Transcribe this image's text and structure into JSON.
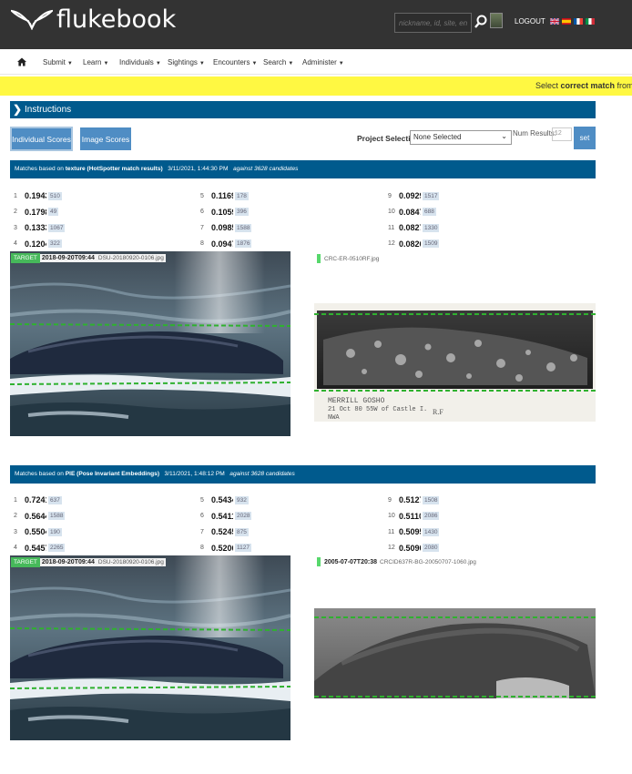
{
  "app": {
    "logo_text": "flukebook",
    "logout": "LOGOUT"
  },
  "search": {
    "placeholder": "nickname, id, site, encou"
  },
  "nav": {
    "items": [
      "Submit",
      "Learn",
      "Individuals",
      "Sightings",
      "Encounters",
      "Search",
      "Administer"
    ]
  },
  "banner": {
    "prefix": "Select ",
    "bold": "correct match",
    "suffix": " from res"
  },
  "instructions": {
    "label": "Instructions"
  },
  "toolbar": {
    "individual_scores": "Individual Scores",
    "image_scores": "Image Scores",
    "project_label": "Project Selection",
    "project_value": "None Selected",
    "num_results_label": "Num Results:",
    "num_results_value": "12",
    "set_label": "set"
  },
  "sections": [
    {
      "bar_prefix": "Matches based on ",
      "algorithm": "texture (HotSpotter match results)",
      "timestamp": "3/11/2021, 1:44:30 PM",
      "candidates": "against 3628 candidates",
      "scores": [
        {
          "rank": "1",
          "value": "0.1943",
          "id": "510"
        },
        {
          "rank": "2",
          "value": "0.1798",
          "id": "49"
        },
        {
          "rank": "3",
          "value": "0.1333",
          "id": "1067"
        },
        {
          "rank": "4",
          "value": "0.1204",
          "id": "322"
        },
        {
          "rank": "5",
          "value": "0.1169",
          "id": "178"
        },
        {
          "rank": "6",
          "value": "0.1059",
          "id": "396"
        },
        {
          "rank": "7",
          "value": "0.0985",
          "id": "1588"
        },
        {
          "rank": "8",
          "value": "0.0947",
          "id": "1876"
        },
        {
          "rank": "9",
          "value": "0.0929",
          "id": "1517"
        },
        {
          "rank": "10",
          "value": "0.0847",
          "id": "688"
        },
        {
          "rank": "11",
          "value": "0.0827",
          "id": "1330"
        },
        {
          "rank": "12",
          "value": "0.0826",
          "id": "1509"
        }
      ],
      "target": {
        "badge": "TARGET",
        "date": "2018-09-20T09:44",
        "file": "DSU-20180920-0106.jpg"
      },
      "candidate": {
        "date": "",
        "file": "CRC-ER-0510RF.jpg"
      },
      "photo_caption": {
        "line1": "MERRILL GOSHO",
        "line2": "21 Oct 80 55W of Castle I.",
        "line3": "NWA",
        "line4": "R.F"
      }
    },
    {
      "bar_prefix": "Matches based on ",
      "algorithm": "PIE (Pose Invariant Embeddings)",
      "timestamp": "3/11/2021, 1:48:12 PM",
      "candidates": "against 3628 candidates",
      "scores": [
        {
          "rank": "1",
          "value": "0.7241",
          "id": "637"
        },
        {
          "rank": "2",
          "value": "0.5644",
          "id": "1588"
        },
        {
          "rank": "3",
          "value": "0.5504",
          "id": "190"
        },
        {
          "rank": "4",
          "value": "0.5457",
          "id": "2265"
        },
        {
          "rank": "5",
          "value": "0.5434",
          "id": "932"
        },
        {
          "rank": "6",
          "value": "0.5411",
          "id": "2028"
        },
        {
          "rank": "7",
          "value": "0.5245",
          "id": "875"
        },
        {
          "rank": "8",
          "value": "0.5206",
          "id": "1127"
        },
        {
          "rank": "9",
          "value": "0.5127",
          "id": "1508"
        },
        {
          "rank": "10",
          "value": "0.5110",
          "id": "2086"
        },
        {
          "rank": "11",
          "value": "0.5095",
          "id": "1430"
        },
        {
          "rank": "12",
          "value": "0.5090",
          "id": "2080"
        }
      ],
      "target": {
        "badge": "TARGET",
        "date": "2018-09-20T09:44",
        "file": "DSU-20180920-0106.jpg"
      },
      "candidate": {
        "date": "2005-07-07T20:38",
        "file": "CRCID637R-BG-20050707-1060.jpg"
      }
    }
  ]
}
